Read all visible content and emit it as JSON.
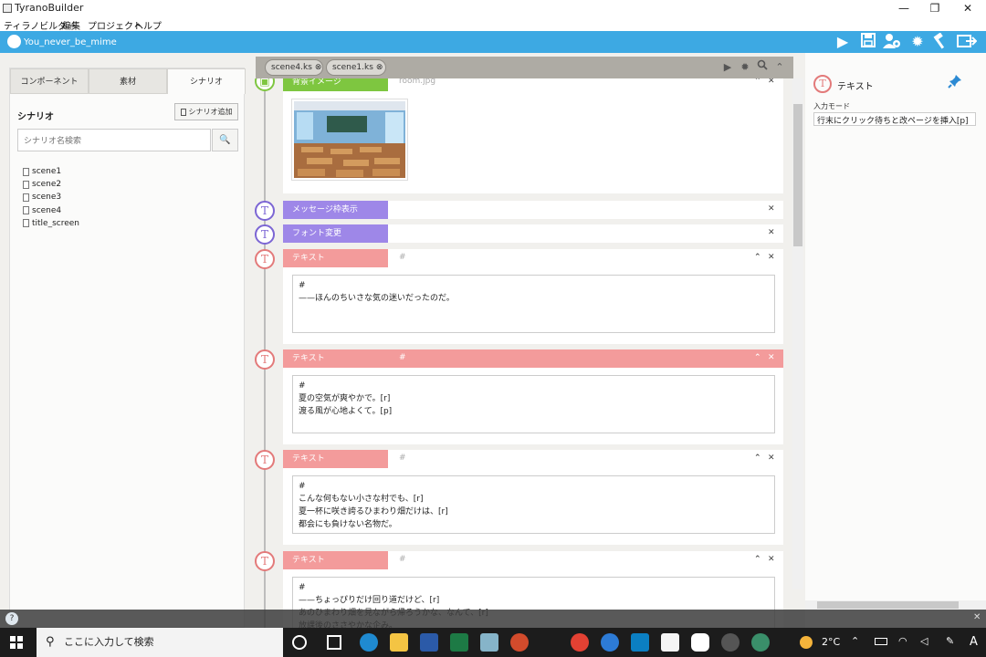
{
  "window": {
    "title": "TyranoBuilder",
    "minimize": "—",
    "restore": "❐",
    "close": "✕"
  },
  "menu": [
    "ティラノビルダー",
    "編集",
    "プロジェクト",
    "ヘルプ"
  ],
  "project": {
    "name": "You_never_be_mime"
  },
  "toolbar_icons": [
    "play-icon",
    "save-icon",
    "user-settings-icon",
    "gear-icon",
    "hammer-icon",
    "export-icon"
  ],
  "left": {
    "tabs": [
      "コンポーネント",
      "素材",
      "シナリオ"
    ],
    "active_tab": "シナリオ",
    "heading": "シナリオ",
    "add_button": "シナリオ追加",
    "search_placeholder": "シナリオ名検索",
    "search_icon": "🔍",
    "files": [
      "scene1",
      "scene2",
      "scene3",
      "scene4",
      "title_screen"
    ]
  },
  "editor": {
    "open_files": [
      {
        "name": "scene4.ks",
        "close": "⊗"
      },
      {
        "name": "scene1.ks",
        "close": "⊗"
      }
    ],
    "tools": [
      "▶",
      "✹",
      "🔍",
      "⌃"
    ],
    "commands": {
      "bg": {
        "label": "背景イメージ",
        "sub": "room.jpg"
      },
      "msgwin": {
        "label": "メッセージ枠表示"
      },
      "font": {
        "label": "フォント変更"
      },
      "text1": {
        "label": "テキスト",
        "sub": "#",
        "body": "#\n——ほんのちいさな気の迷いだったのだ。"
      },
      "text2": {
        "label": "テキスト",
        "sub": "#",
        "body": "#\n夏の空気が爽やかで。[r]\n渡る風が心地よくて。[p]"
      },
      "text3": {
        "label": "テキスト",
        "sub": "#",
        "body": "#\nこんな何もない小さな村でも、[r]\n夏一杯に咲き誇るひまわり畑だけは、[r]\n都会にも負けない名物だ。"
      },
      "text4": {
        "label": "テキスト",
        "sub": "#",
        "body": "#\n——ちょっぴりだけ回り道だけど、[r]\nあのひまわり畑を見ながら帰ろうかな、なんて、[r]\n放課後のささやかな企み。"
      }
    },
    "text_icon": "T",
    "collapse": "⌃",
    "remove": "✕"
  },
  "inspector": {
    "title": "テキスト",
    "mode_label": "入力モード",
    "mode_value": "行末にクリック待ちと改ページを挿入[p]"
  },
  "taskbar": {
    "search_placeholder": "ここに入力して検索",
    "temperature": "2°C",
    "ime": "A"
  },
  "colors": {
    "accent": "#3da9e3",
    "text_cmd": "#f39b9b",
    "text_cmd_active": "#f27f7f",
    "msg_cmd": "#9e87e8",
    "bg_cmd": "#7ec640"
  }
}
